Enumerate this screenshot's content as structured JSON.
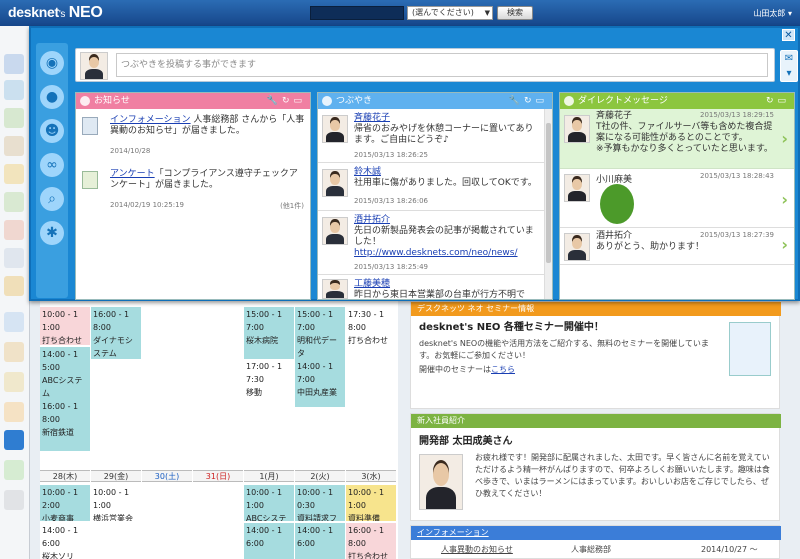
{
  "app": {
    "logo_prefix": "desknet",
    "logo_s": "'s",
    "logo_suffix": "NEO",
    "select_placeholder": "(選んでください)",
    "search_label": "検索",
    "user_name": "山田太郎"
  },
  "post": {
    "placeholder": "つぶやきを投稿する事ができます"
  },
  "notices": {
    "title": "お知らせ",
    "items": [
      {
        "link": "インフォメーション",
        "text": " 人事総務部 さんから「人事異動のお知らせ」が届きました。",
        "date": "2014/10/28"
      },
      {
        "link": "アンケート",
        "text": "「コンプライアンス遵守チェックアンケート」が届きました。",
        "date": "2014/02/19 10:25:19",
        "count": "(他1件)"
      }
    ]
  },
  "tweets": {
    "title": "つぶやき",
    "items": [
      {
        "name": "斉藤花子",
        "text": "帰省のおみやげを休憩コーナーに置いてあります。ご自由にどうぞ♪",
        "date": "2015/03/13 18:26:25"
      },
      {
        "name": "鈴木誠",
        "text": "社用車に傷がありました。回収してOKです。",
        "date": "2015/03/13 18:26:06"
      },
      {
        "name": "酒井拓介",
        "text": "先日の新製品発表会の記事が掲載されていました！",
        "url": "http://www.desknets.com/neo/news/",
        "date": "2015/03/13 18:25:49"
      },
      {
        "name": "工藤美穂",
        "text": "昨日から東日本営業部の台車が行方不明です。ど"
      }
    ]
  },
  "dm": {
    "title": "ダイレクトメッセージ",
    "items": [
      {
        "name": "斉藤花子",
        "date": "2015/03/13 18:29:15",
        "text": "T社の件、ファイルサーバ等も含めた複合提案になる可能性があるとのことです。",
        "note": "※予算もかなり多くとっていたと思います。"
      },
      {
        "name": "小川麻美",
        "date": "2015/03/13 18:28:43"
      },
      {
        "name": "酒井拓介",
        "date": "2015/03/13 18:27:39",
        "text": "ありがとう、助かります！"
      }
    ]
  },
  "calendar": {
    "days": [
      {
        "label": "28(木)"
      },
      {
        "label": "29(金)"
      },
      {
        "label": "30(土)"
      },
      {
        "label": "31(日)"
      },
      {
        "label": "1(月)"
      },
      {
        "label": "2(火)"
      },
      {
        "label": "3(水)"
      }
    ],
    "top_events": [
      {
        "t1": "10:00 - 1",
        "t2": "1:00",
        "title": "打ち合わせ"
      },
      {
        "t1": "14:00 - 1",
        "t2": "5:00",
        "title": "ABCシステム"
      },
      {
        "t1": "16:00 - 1",
        "t2": "8:00",
        "title": "新宿鉄道"
      },
      {
        "t1": "16:00 - 1",
        "t2": "8:00",
        "title": "ダイナモシステム"
      },
      {
        "t1": "15:00 - 1",
        "t2": "7:00",
        "title": "桜木病院"
      },
      {
        "t1": "17:00 - 1",
        "t2": "7:30",
        "title": "移動"
      },
      {
        "t1": "15:00 - 1",
        "t2": "7:00",
        "title": "明和代データ"
      },
      {
        "t1": "14:00 - 1",
        "t2": "7:00",
        "title": "中田丸産業"
      },
      {
        "t1": "17:30 - 1",
        "t2": "8:00",
        "title": "打ち合わせ"
      }
    ],
    "bottom_events": [
      {
        "t1": "10:00 - 1",
        "t2": "2:00",
        "title": "小麦商事"
      },
      {
        "t1": "14:00 - 1",
        "t2": "6:00",
        "title": "桜木ソリ"
      },
      {
        "t1": "10:00 - 1",
        "t2": "1:00",
        "title": "横浜営業会議"
      },
      {
        "t1": "10:00 - 1",
        "t2": "1:00",
        "title": "ABCシステム"
      },
      {
        "t1": "14:00 - 1",
        "t2": "6:00",
        "title": ""
      },
      {
        "t1": "10:00 - 1",
        "t2": "0:30",
        "title": "資料請求フォロー"
      },
      {
        "t1": "14:00 - 1",
        "t2": "6:00",
        "title": ""
      },
      {
        "t1": "10:00 - 1",
        "t2": "1:00",
        "title": "資料準備"
      },
      {
        "t1": "16:00 - 1",
        "t2": "8:00",
        "title": "打ち合わせ"
      }
    ]
  },
  "seminar": {
    "header": "デスクネッツ ネオ セミナー情報",
    "title": "desknet's NEO 各種セミナー開催中！",
    "body": "desknet's NEOの機能や活用方法をご紹介する、無料のセミナーを開催しています。お気軽にご参加ください！",
    "pre": "開催中のセミナーは",
    "link": "こちら"
  },
  "newcomer": {
    "header": "新入社員紹介",
    "title": "開発部 太田成美さん",
    "body": "お疲れ様です！開発部に配属されました、太田です。早く皆さんに名前を覚えていただけるよう精一杯がんばりますので、何卒よろしくお願いいたします。趣味は食べ歩きで、いまはラーメンにはまっています。おいしいお店をご存じでしたら、ぜひ教えてください！"
  },
  "info": {
    "header": "インフォメーション",
    "row_link": "人事異動のお知らせ",
    "row_dept": "人事総務部",
    "row_date": "2014/10/27 〜"
  },
  "colors": {
    "header": "#1d5aa3",
    "overlay": "#1a87d3",
    "notice": "#f07fa2",
    "tweet": "#5fb1ef",
    "dm": "#8cc63f",
    "seminar": "#f29a1d",
    "newcomer": "#7cb342",
    "info": "#3b7dd8"
  }
}
